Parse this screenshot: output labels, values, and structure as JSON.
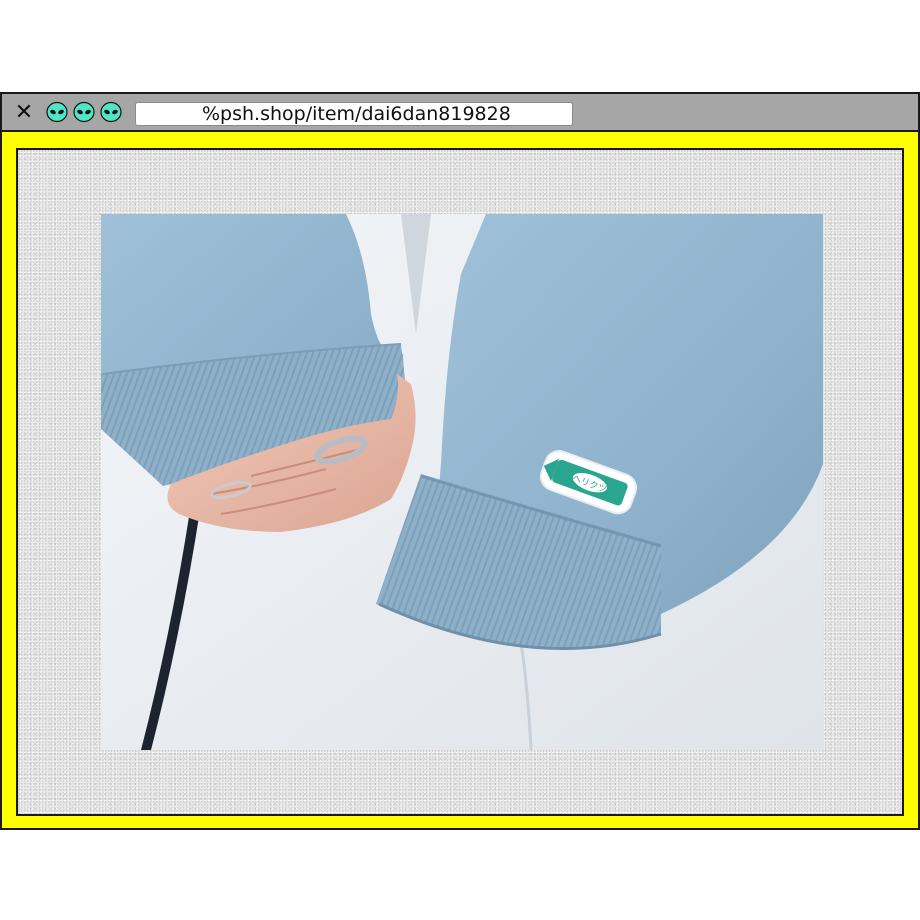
{
  "browser": {
    "url": "%psh.shop/item/dai6dan819828",
    "close_icon": "close-icon",
    "tab_icons": [
      "alien-icon",
      "alien-icon",
      "alien-icon"
    ],
    "colors": {
      "frame": "#ffff00",
      "titlebar": "#a6a6a6",
      "alien": "#4ee6c4"
    }
  },
  "product_photo": {
    "subject": "light-blue sweatshirt sleeve with embroidered patch",
    "patch_text": "ヘリクツ"
  }
}
